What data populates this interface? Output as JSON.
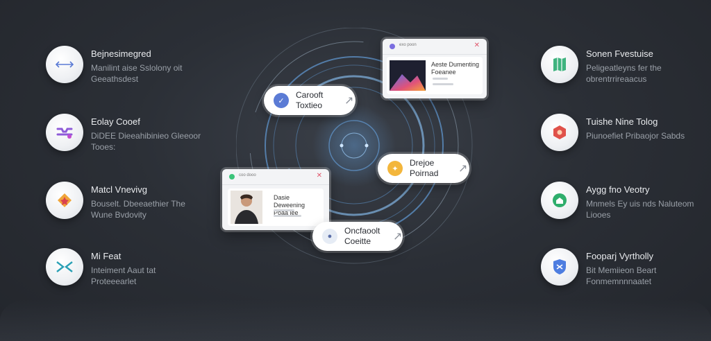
{
  "left_features": [
    {
      "title": "Bejnesimegred",
      "desc": "Manilint aise Sslolony oit Geeathsdest",
      "icon": "double-arrow-icon",
      "color": "#5b7bd5"
    },
    {
      "title": "Eolay Cooef",
      "desc": "DiDEE Dieeahibinieo Gleeoor Tooes:",
      "icon": "layers-icon",
      "color": "#8e5bd8"
    },
    {
      "title": "Matcl Vnevivg",
      "desc": "Bouselt. Dbeeaethier The Wune Bvdovity",
      "icon": "star-icon",
      "color": "#e26b4a"
    },
    {
      "title": "Mi Feat",
      "desc": "Inteiment Aaut tat Proteeearlet",
      "icon": "bowtie-icon",
      "color": "#2aa0b5"
    }
  ],
  "right_features": [
    {
      "title": "Sonen Fvestuise",
      "desc": "Peligeatleyns fer the obrentrrireaacus",
      "icon": "map-icon",
      "color": "#3fb37f"
    },
    {
      "title": "Tuishe Nine Tolog",
      "desc": "Piunoefiet Pribaojor Sabds",
      "icon": "badge-icon",
      "color": "#e0524a"
    },
    {
      "title": "Aygg fno Veotry",
      "desc": "Mnmels Ey uis nds Naluteom Liooes",
      "icon": "home-icon",
      "color": "#2fae6c"
    },
    {
      "title": "Fooparj Vyrtholly",
      "desc": "Bit Memiieon Beart Fonmemnnnaatet",
      "icon": "shield-icon",
      "color": "#4d7de0"
    }
  ],
  "pills": [
    {
      "label": "Carooft Toxtieo",
      "icon": "blue-check-icon",
      "color": "#5b7bd5"
    },
    {
      "label": "Drejoe Poirnad",
      "icon": "yellow-spark-icon",
      "color": "#f3b63c"
    },
    {
      "label": "Oncfaoolt Coeitte",
      "icon": "avatar-icon",
      "color": "#7c8aa8"
    }
  ],
  "cards": [
    {
      "title": "Aeste Dumenting Foeanee",
      "bar_text": "exo poon"
    },
    {
      "title": "Dasie Deweening Poaa lee",
      "bar_text": "coo dooo"
    }
  ],
  "colors": {
    "accent_ring": "#6fb7ff",
    "background": "#2b2f36"
  }
}
